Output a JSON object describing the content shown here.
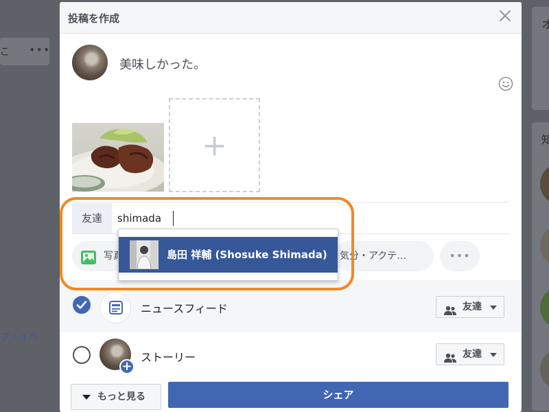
{
  "modal": {
    "title": "投稿を作成",
    "post_text": "美味しかった。"
  },
  "tag": {
    "label": "友達",
    "input_value": "shimada",
    "suggestion_name": "島田 祥輔 (Shosuke Shimada)"
  },
  "actions": {
    "photo_label": "写真",
    "feeling_label": "気分・アクテ…",
    "more_label": "•••"
  },
  "destinations": {
    "news_feed": {
      "label": "ニュースフィード",
      "checked": true,
      "audience": "友達"
    },
    "story": {
      "label": "ストーリー",
      "checked": false,
      "audience": "友達"
    }
  },
  "footer": {
    "more_label": "もっと見る",
    "share_label": "シェア"
  },
  "background": {
    "left_text": "こ",
    "left_dots": "•••",
    "left_link": "プ・イベ",
    "right_heading_1": "オ",
    "right_heading_2": "知"
  },
  "colors": {
    "accent": "#4267b2",
    "suggestion_bg": "#365899",
    "highlight": "#ee8a23"
  },
  "icons": {
    "close": "close-icon",
    "emoji": "smiley-icon",
    "photo": "photo-icon",
    "feed": "news-feed-icon",
    "audience": "friends-icon"
  }
}
